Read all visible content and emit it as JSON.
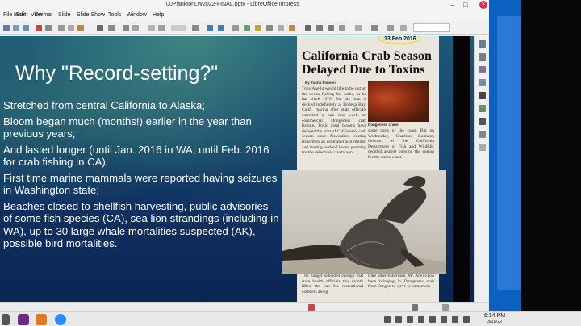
{
  "window": {
    "title": "00PlanktonLW2022-FINAL.pptx - LibreOffice Impress",
    "controls": {
      "minimize": "–",
      "maximize": "□",
      "close": "×"
    }
  },
  "menu": [
    "File",
    "Edit",
    "View",
    "Insert",
    "Format",
    "Slide",
    "Slide Show",
    "Tools",
    "Window",
    "Help"
  ],
  "slide": {
    "title": "Why \"Record-setting?\"",
    "bullets": [
      "Stretched from central California to Alaska;",
      "Bloom began much (months!) earlier in the year than previous years;",
      "And lasted longer (until Jan. 2016 in WA, until Feb. 2016 for crab fishing in CA).",
      "First time marine mammals were reported having seizures in Washington state;",
      "Beaches closed to shellfish harvesting, public advisories of some fish species (CA), sea lion strandings (including in WA), up to 30 large whale mortalities suspected (AK), possible bird mortalities."
    ],
    "newspaper": {
      "date_note": "13 Feb 2016",
      "headline": "California Crab Season Delayed Due to Toxins",
      "byline": "By Zusha Elinson",
      "col1": "Tony Anello would like to be out on the ocean fishing for crabs, as he has since 1970. But his boat is docked indefinitely at Bodega Bay, Calif., marina after state officials extended a ban last week on commercial Dungeness crab fishing. Toxic algal blooms have delayed the start of California's crab season since November, costing fishermen an estimated $48 million and leaving seafood lovers yearning for the delectable crustacean.",
      "photo_caption": "Dungeness crabs",
      "col2": "some parts of the coast. But on Wednesday, Charlton Bonham, director of the California Department of Fish and Wildlife, decided against opening the season for the entire coast.",
      "bottom_left": "The danger subsided enough that state health officials this month lifted the ban for recreational crabbers along",
      "bottom_right": "Like other fishermen, Mr. Anello has been bringing in Dungeness crab from Oregon to serve to customers."
    }
  },
  "clock": {
    "time": "6:14 PM",
    "date": "3/18/22"
  },
  "colors": {
    "title_bar": "#f4f4f4",
    "close_button": "#e0304e",
    "slide_text": "#ffffff",
    "desktop": "#0d5fc0"
  },
  "icons": {
    "sidebar": [
      "properties-icon",
      "slide-transition-icon",
      "animation-icon",
      "master-slides-icon",
      "styles-icon",
      "gallery-icon",
      "navigator-icon",
      "shapes-icon"
    ],
    "taskbar": [
      "start-icon",
      "impress-app-icon",
      "files-app-icon",
      "zoom-app-icon"
    ]
  }
}
